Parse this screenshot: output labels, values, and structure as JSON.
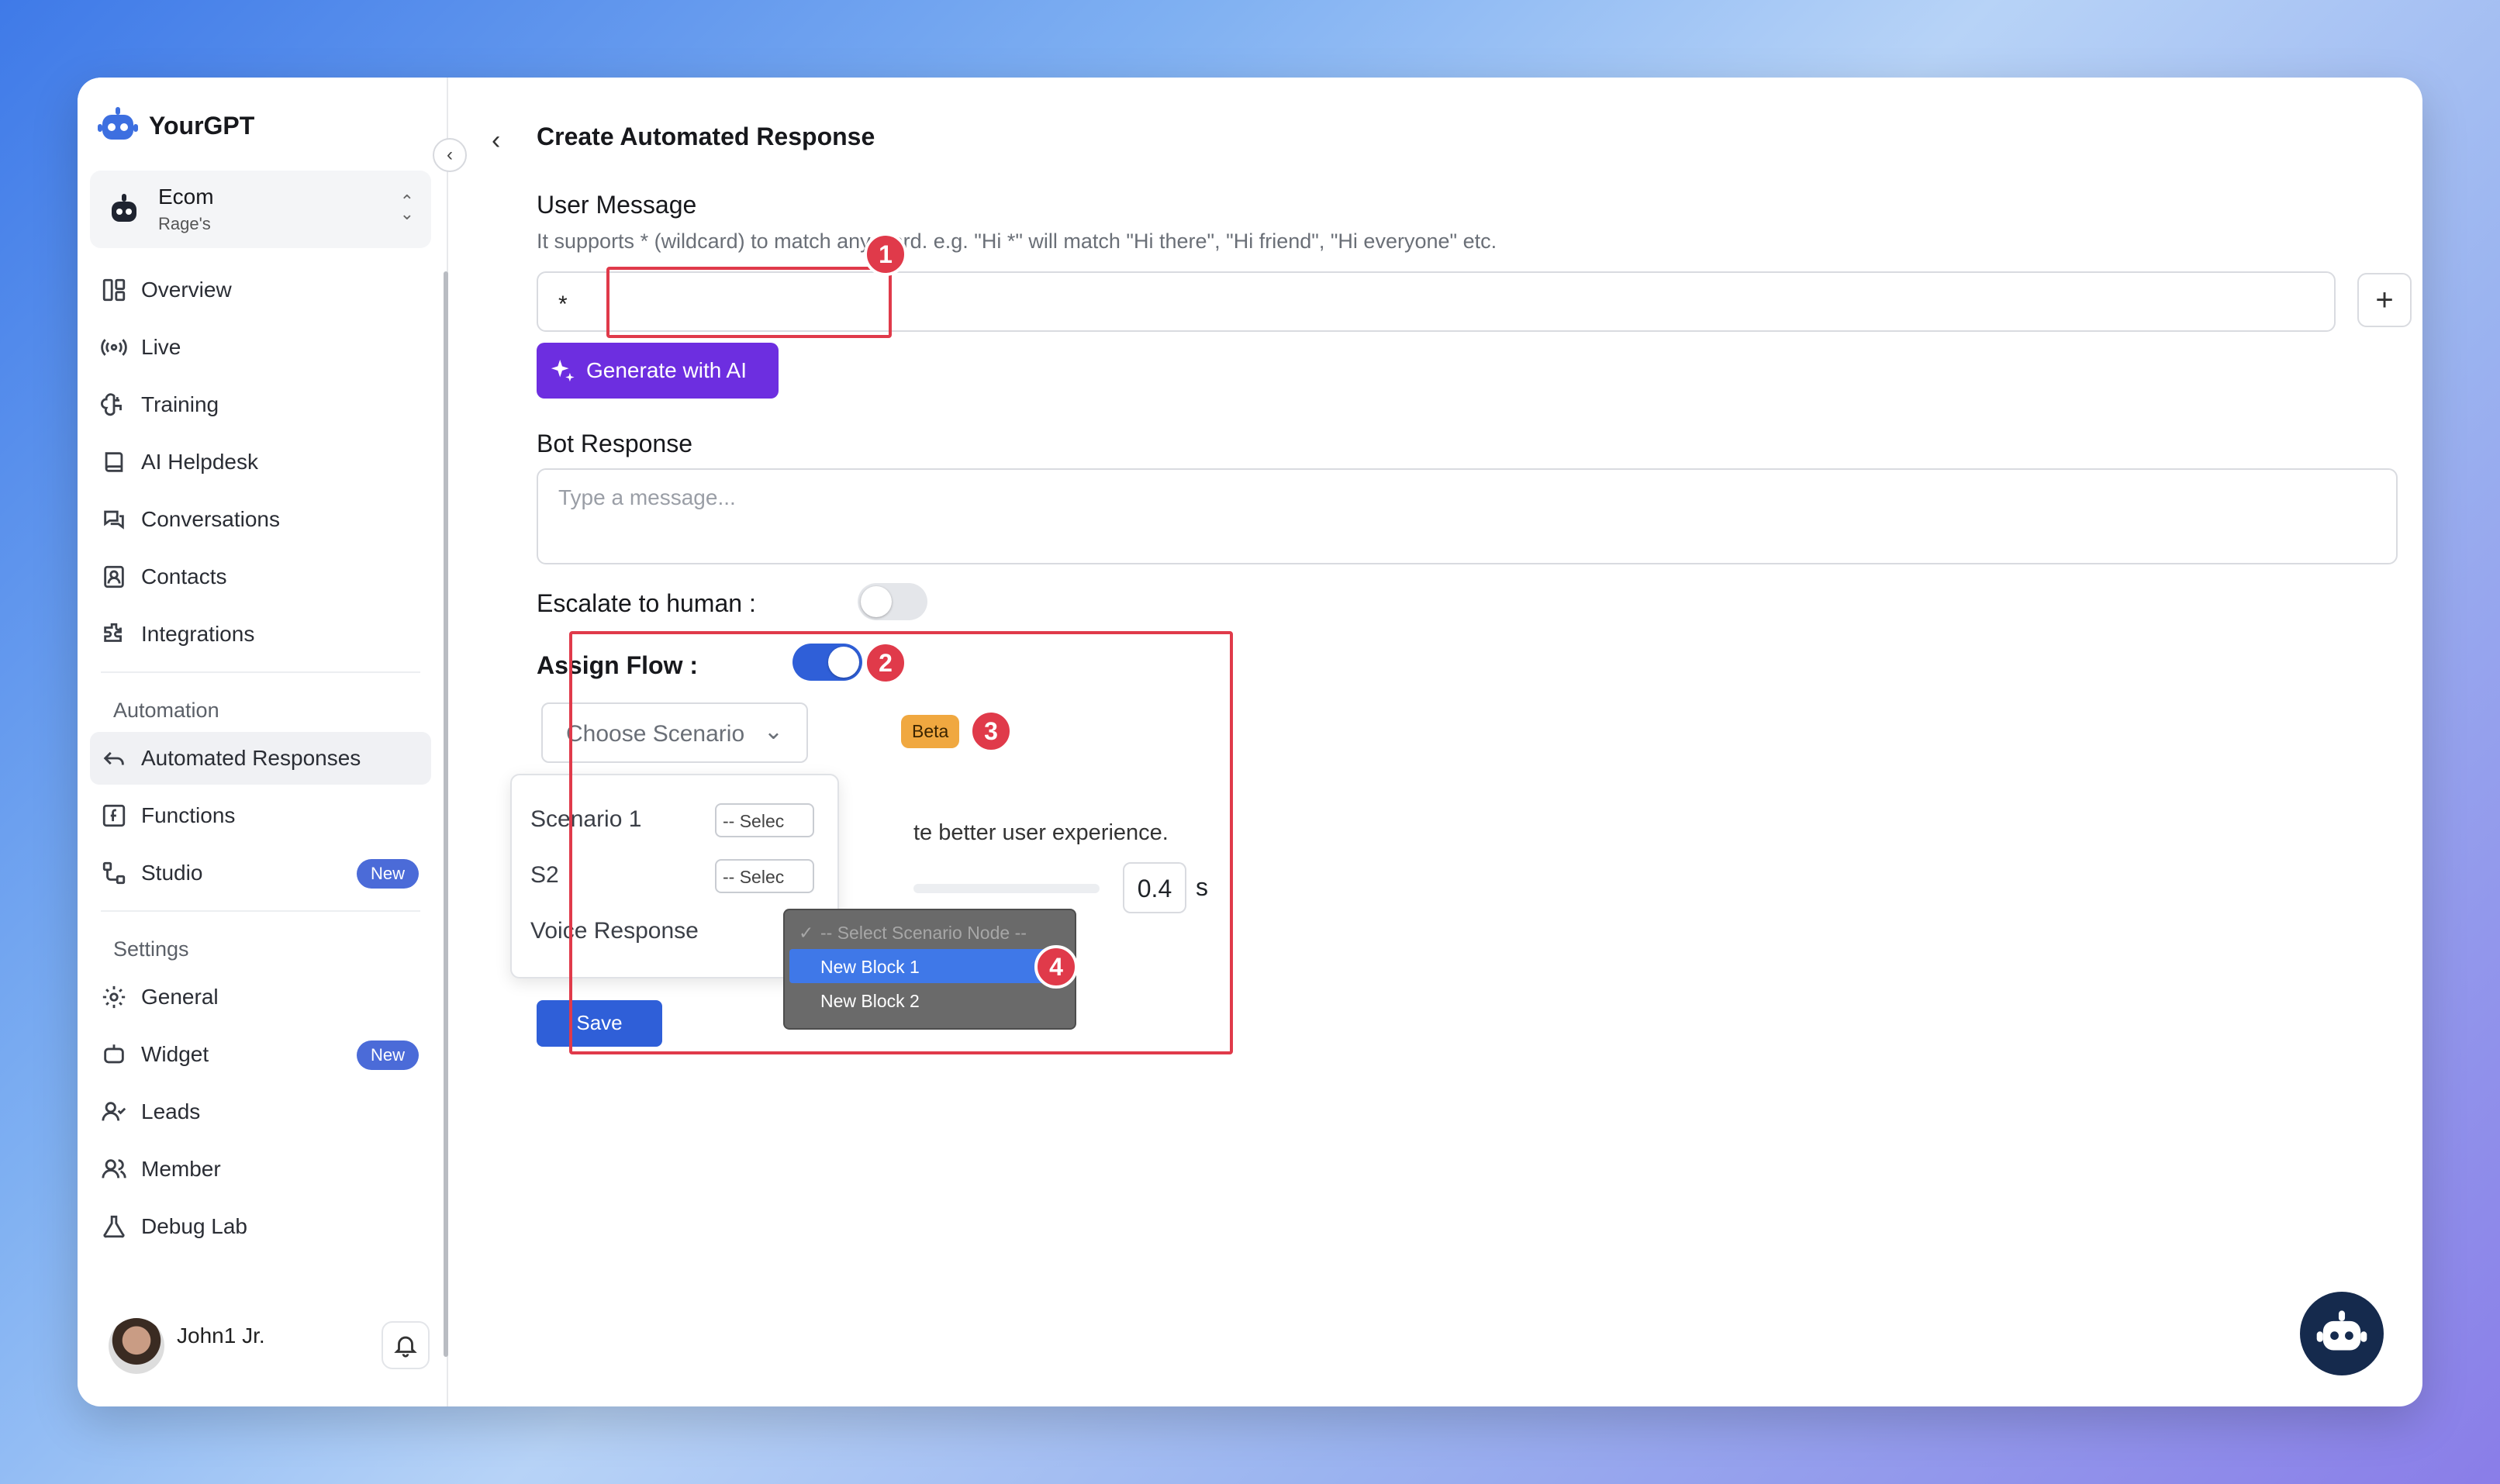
{
  "brand": {
    "name": "YourGPT"
  },
  "project": {
    "name": "Ecom",
    "sub": "Rage's"
  },
  "nav": {
    "items": [
      {
        "label": "Overview"
      },
      {
        "label": "Live"
      },
      {
        "label": "Training"
      },
      {
        "label": "AI Helpdesk"
      },
      {
        "label": "Conversations"
      },
      {
        "label": "Contacts"
      },
      {
        "label": "Integrations"
      }
    ],
    "automation_header": "Automation",
    "automation_items": [
      {
        "label": "Automated Responses"
      },
      {
        "label": "Functions"
      },
      {
        "label": "Studio",
        "badge": "New"
      }
    ],
    "settings_header": "Settings",
    "settings_items": [
      {
        "label": "General"
      },
      {
        "label": "Widget",
        "badge": "New"
      },
      {
        "label": "Leads"
      },
      {
        "label": "Member"
      },
      {
        "label": "Debug Lab"
      }
    ]
  },
  "user": {
    "name": "John1 Jr."
  },
  "page": {
    "title": "Create Automated Response",
    "user_message_label": "User Message",
    "user_message_help": "It supports * (wildcard) to match any word. e.g. \"Hi *\" will match \"Hi there\", \"Hi friend\", \"Hi everyone\" etc.",
    "user_message_value": "*",
    "generate_label": "Generate with AI",
    "bot_response_label": "Bot Response",
    "bot_response_placeholder": "Type a message...",
    "escalate_label": "Escalate to human :",
    "escalate_on": false,
    "assign_flow_label": "Assign Flow :",
    "assign_flow_on": true,
    "choose_scenario": "Choose Scenario",
    "beta": "Beta",
    "partial_text": "te better user experience.",
    "delay_value": "0.4",
    "delay_unit": "s",
    "save_label": "Save"
  },
  "scenario_popover": {
    "rows": [
      {
        "name": "Scenario 1",
        "select": "-- Selec"
      },
      {
        "name": "S2",
        "select": "-- Selec"
      },
      {
        "name": "Voice Response",
        "select": ""
      }
    ]
  },
  "node_dropdown": {
    "options": [
      {
        "label": "-- Select Scenario Node --",
        "checked": true
      },
      {
        "label": "New Block 1",
        "highlighted": true
      },
      {
        "label": "New Block 2"
      }
    ]
  },
  "annotations": [
    "1",
    "2",
    "3",
    "4"
  ],
  "colors": {
    "accent": "#2f5fd8",
    "generate": "#6d2ee0",
    "annotation": "#e03a4a",
    "beta": "#f0a840"
  }
}
